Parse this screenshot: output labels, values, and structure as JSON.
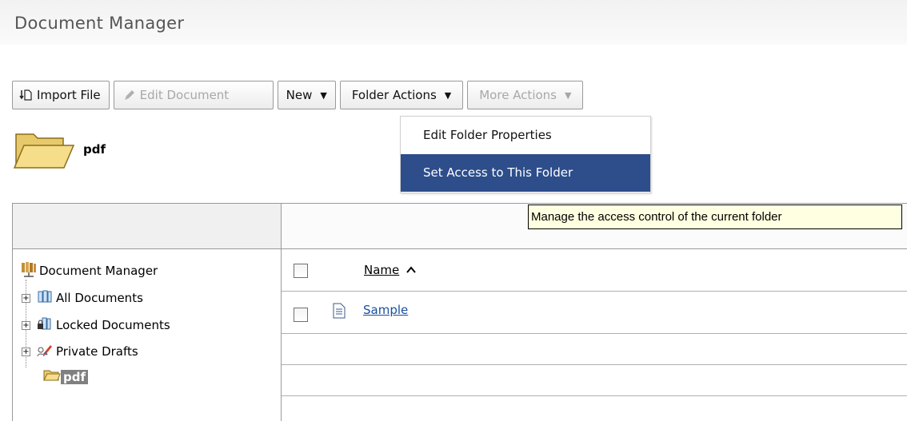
{
  "page": {
    "title": "Document Manager"
  },
  "toolbar": {
    "import_file": "Import File",
    "edit_document": "Edit Document",
    "new": "New",
    "folder_actions": "Folder Actions",
    "more_actions": "More Actions"
  },
  "folder": {
    "name": "pdf"
  },
  "folder_actions_menu": {
    "items": [
      "Edit Folder Properties",
      "Set Access to This Folder"
    ],
    "highlighted": "Set Access to This Folder"
  },
  "tooltip": {
    "text": "Manage the access control of the current folder"
  },
  "tree": {
    "root": "Document Manager",
    "items": [
      {
        "label": "All Documents",
        "icon": "library-icon"
      },
      {
        "label": "Locked Documents",
        "icon": "locked-library-icon"
      },
      {
        "label": "Private Drafts",
        "icon": "private-drafts-icon"
      },
      {
        "label": "pdf",
        "icon": "open-folder-icon",
        "selected": true
      }
    ]
  },
  "list": {
    "column_name": "Name",
    "sort_indicator": "^",
    "rows": [
      {
        "name": "Sample",
        "icon": "document-icon"
      }
    ]
  },
  "colors": {
    "menu_highlight": "#2d4d8b",
    "tooltip_bg": "#ffffe1",
    "link": "#1a4fa0"
  }
}
